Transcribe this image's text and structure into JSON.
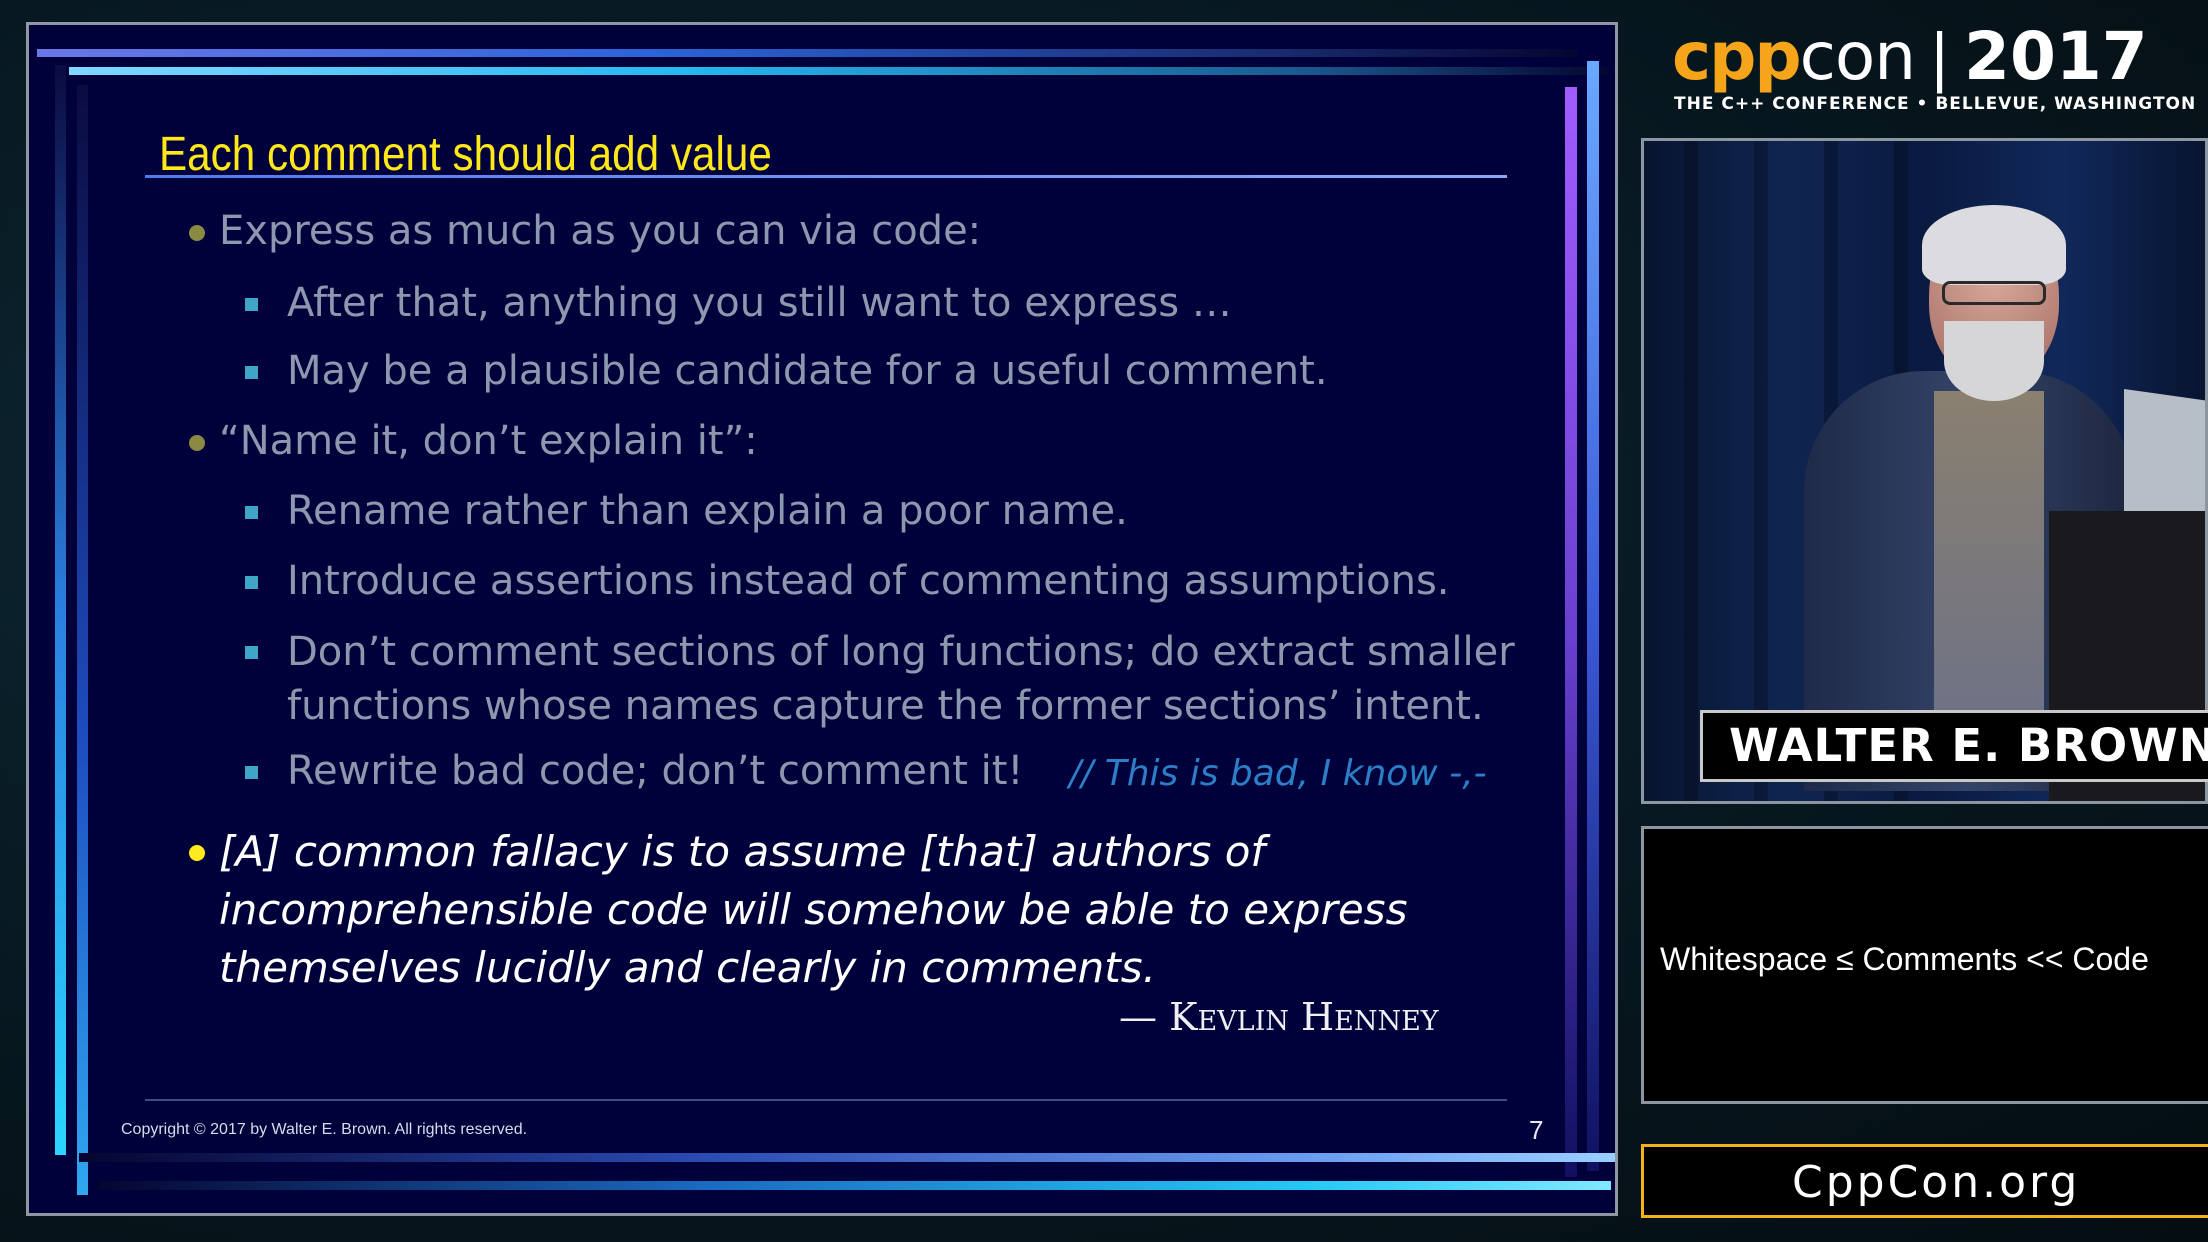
{
  "slide": {
    "title": "Each comment should add value",
    "bullets": [
      {
        "text": "Express as much as you can via code:",
        "subs": [
          "After that, anything you still want to express …",
          "May be a plausible candidate for a useful comment."
        ]
      },
      {
        "text": "“Name it, don’t explain it”:",
        "subs": [
          "Rename rather than explain a poor name.",
          "Introduce assertions instead of commenting assumptions.",
          "Don’t comment sections of long functions; do extract smaller",
          "functions whose names capture the former sections’ intent.",
          "Rewrite bad code; don’t comment it!"
        ]
      }
    ],
    "comment_note": "// This is bad, I know -,-",
    "quote": {
      "line1": "[A] common fallacy is to assume [that] authors of",
      "line2": "incomprehensible code will somehow be able to express",
      "line3": "themselves lucidly and clearly in comments.",
      "author": "— Kevlin Henney"
    },
    "copyright": "Copyright © 2017 by Walter E. Brown.  All rights reserved.",
    "page_number": "7",
    "colors": {
      "background": "#00003a",
      "title": "#ffe81a",
      "body_text": "#8d98ae",
      "quote_text": "#ffffff",
      "comment": "#2b7fc8",
      "bullet_dim": "#8a8a42",
      "bullet_bright": "#ffea1a"
    }
  },
  "branding": {
    "logo_cpp": "cpp",
    "logo_con": "con",
    "separator": "|",
    "year": "2017",
    "tagline": "THE C++ CONFERENCE • BELLEVUE, WASHINGTON",
    "accent_color": "#f6a51a"
  },
  "speaker": {
    "name": "WALTER E. BROWN"
  },
  "talk": {
    "title": "Whitespace ≤ Comments << Code"
  },
  "site": {
    "url": "CppCon.org"
  }
}
